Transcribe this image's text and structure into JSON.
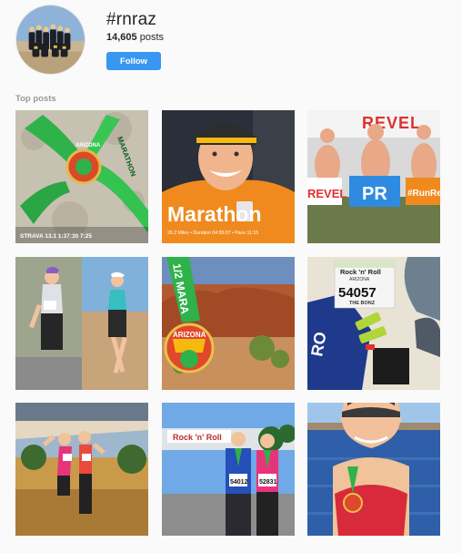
{
  "header": {
    "hashtag": "#rnraz",
    "posts_count": "14,605",
    "posts_label": "posts",
    "follow_label": "Follow"
  },
  "section": {
    "title": "Top posts"
  },
  "posts": [
    {
      "overlay": "STRAVA   13.1   1:37:30   7:25",
      "medal": "ARIZONA",
      "ribbon": "MARATHON"
    },
    {
      "overlay": "Marathon",
      "sub": "26.2 Miles • Duration 04:55:07 • Pace 11:15"
    },
    {
      "signs": [
        "REVEL",
        "PR",
        "#RunRev"
      ],
      "banner": "REVEL"
    },
    {},
    {
      "ribbon": "1/2 MARA",
      "medal": "ARIZONA"
    },
    {
      "bib_title": "Rock 'n' Roll",
      "bib_sub": "ARIZONA",
      "bib_number": "54057",
      "bib_name": "THE BONZ"
    },
    {},
    {
      "banner": "Rock 'n' Roll",
      "bibs": [
        "54012",
        "52831"
      ]
    },
    {}
  ]
}
